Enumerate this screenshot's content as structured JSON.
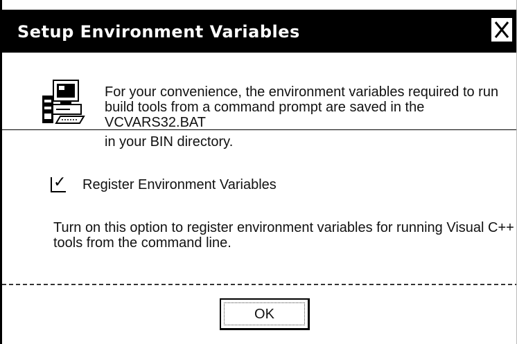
{
  "window": {
    "title": "Setup Environment Variables",
    "close_icon": "close-icon"
  },
  "message": {
    "line1": "For your convenience, the environment variables required to run",
    "line2": "build tools from a command prompt are saved in the",
    "line3": "VCVARS32.BAT",
    "line4": "in your BIN directory.",
    "icon": "computer-icon"
  },
  "option": {
    "checked": true,
    "check_glyph": "✓",
    "label": "Register Environment Variables"
  },
  "description": {
    "line1": "Turn on this option to register environment variables for running Visual C++",
    "line2": "tools from the command line."
  },
  "buttons": {
    "ok_label": "OK"
  },
  "colors": {
    "titlebar": "#000000",
    "title_text": "#ffffff",
    "background": "#ffffff"
  }
}
